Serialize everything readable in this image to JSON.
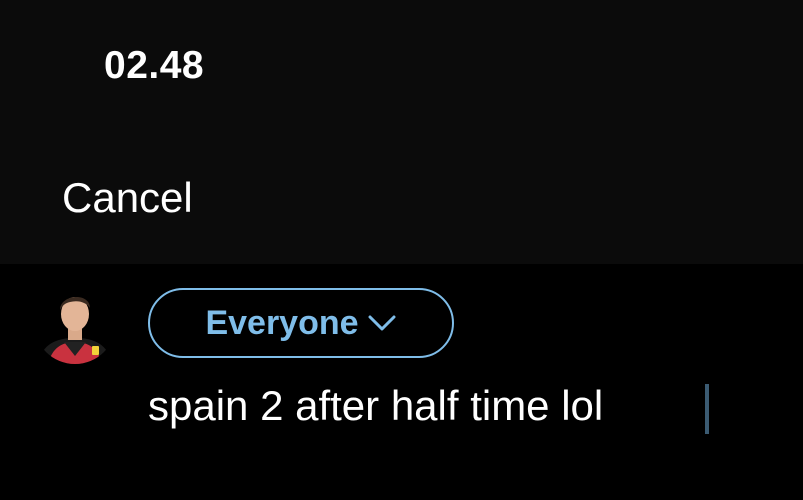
{
  "status_bar": {
    "time": "02.48"
  },
  "header": {
    "cancel_label": "Cancel"
  },
  "composer": {
    "audience_label": "Everyone",
    "audience_icon": "chevron-down-icon",
    "text": "spain 2 after half time lol",
    "avatar_icon": "avatar"
  },
  "colors": {
    "accent": "#7fbde9",
    "background": "#000000",
    "header_background": "#0b0b0b",
    "text": "#ffffff"
  }
}
